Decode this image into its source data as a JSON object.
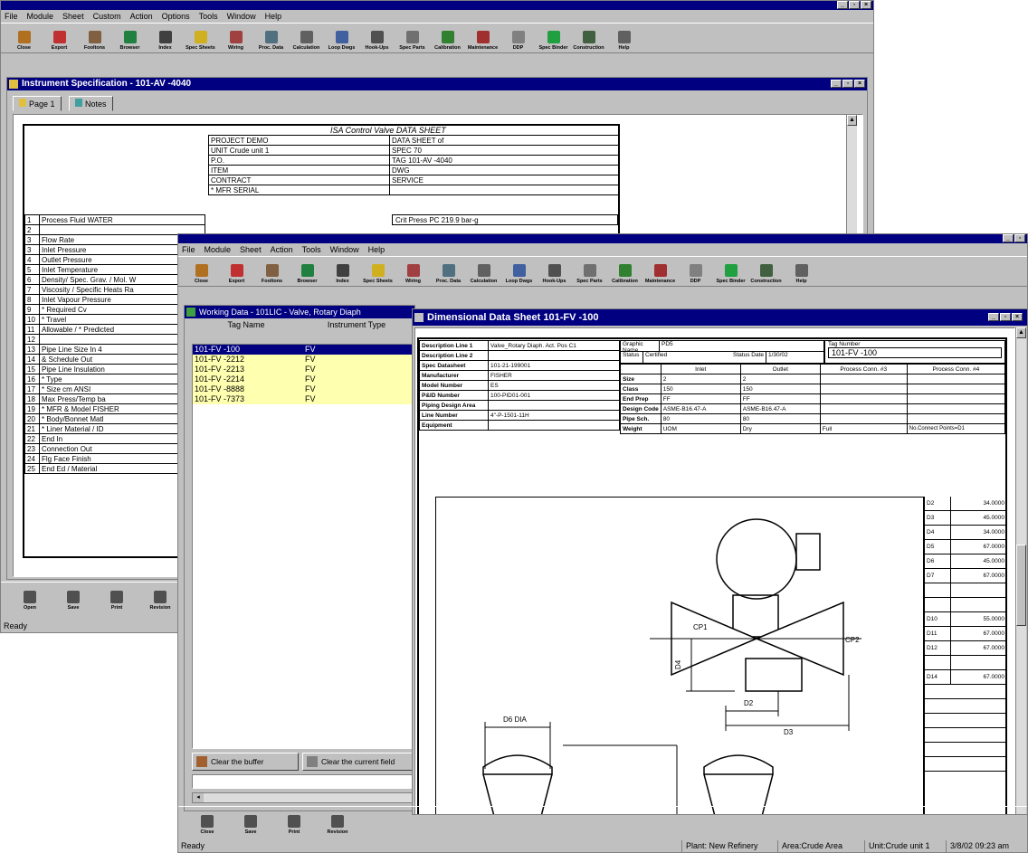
{
  "back_window": {
    "menu": [
      "File",
      "Module",
      "Sheet",
      "Custom",
      "Action",
      "Options",
      "Tools",
      "Window",
      "Help"
    ],
    "toolbar": [
      {
        "label": "Close",
        "icon": "close-icon",
        "color": "#b07020"
      },
      {
        "label": "Export",
        "icon": "export-icon",
        "color": "#c03030"
      },
      {
        "label": "Fooltons",
        "icon": "toolbox-icon",
        "color": "#806040"
      },
      {
        "label": "Browser",
        "icon": "browser-icon",
        "color": "#208040"
      },
      {
        "label": "Index",
        "icon": "index-icon",
        "color": "#404040"
      },
      {
        "label": "Spec Sheets",
        "icon": "spec-sheets-icon",
        "color": "#d0b020"
      },
      {
        "label": "Wiring",
        "icon": "wiring-icon",
        "color": "#a04040"
      },
      {
        "label": "Proc. Data",
        "icon": "process-data-icon",
        "color": "#507080"
      },
      {
        "label": "Calculation",
        "icon": "calculation-icon",
        "color": "#606060"
      },
      {
        "label": "Loop Dwgs",
        "icon": "loop-drawings-icon",
        "color": "#4060a0"
      },
      {
        "label": "Hook-Ups",
        "icon": "hook-ups-icon",
        "color": "#505050"
      },
      {
        "label": "Spec Parts",
        "icon": "spec-parts-icon",
        "color": "#707070"
      },
      {
        "label": "Calibration",
        "icon": "calibration-icon",
        "color": "#308030"
      },
      {
        "label": "Maintenance",
        "icon": "maintenance-icon",
        "color": "#a03030"
      },
      {
        "label": "DDP",
        "icon": "ddp-icon",
        "color": "#808080"
      },
      {
        "label": "Spec Binder",
        "icon": "spec-binder-icon",
        "color": "#20a040"
      },
      {
        "label": "Construction",
        "icon": "construction-icon",
        "color": "#406040"
      },
      {
        "label": "Help",
        "icon": "help-icon",
        "color": "#606060"
      }
    ],
    "spec_title": "Instrument Specification - 101-AV  -4040",
    "tabs": [
      "Page 1",
      "Notes"
    ],
    "sheet_title": "ISA Control Valve DATA SHEET",
    "header_left": [
      "PROJECT  DEMO",
      "UNIT  Crude unit 1",
      "P.O.",
      "ITEM",
      "CONTRACT",
      "* MFR SERIAL"
    ],
    "header_right": [
      "DATA SHEET         of",
      "SPEC  70",
      "TAG  101-AV  -4040",
      "DWG",
      "SERVICE",
      ""
    ],
    "rows": [
      {
        "n": "1",
        "t": "Process Fluid  WATER"
      },
      {
        "n": "2",
        "t": ""
      },
      {
        "n": "3",
        "t": "Flow Rate"
      },
      {
        "n": "3",
        "t": "Inlet Pressure"
      },
      {
        "n": "4",
        "t": "Outlet Pressure"
      },
      {
        "n": "5",
        "t": "Inlet Temperature"
      },
      {
        "n": "6",
        "t": "Density/ Spec. Grav. / Mol. W"
      },
      {
        "n": "7",
        "t": "Viscosity / Specific Heats Ra"
      },
      {
        "n": "8",
        "t": "Inlet Vapour Pressure"
      },
      {
        "n": "9",
        "t": "* Required Cv"
      },
      {
        "n": "10",
        "t": "* Travel"
      },
      {
        "n": "11",
        "t": "Allowable / * Predicted"
      },
      {
        "n": "12",
        "t": ""
      },
      {
        "n": "13",
        "t": "Pipe Line Size      In   4"
      },
      {
        "n": "14",
        "t": "& Schedule          Out"
      },
      {
        "n": "15",
        "t": "Pipe Line Insulation"
      },
      {
        "n": "16",
        "t": "* Type"
      },
      {
        "n": "17",
        "t": "* Size          cm     ANSI"
      },
      {
        "n": "18",
        "t": "Max Press/Temp         ba"
      },
      {
        "n": "19",
        "t": "* MFR & Model  FISHER"
      },
      {
        "n": "20",
        "t": "* Body/Bonnet Matl"
      },
      {
        "n": "21",
        "t": "* Liner Material / ID"
      },
      {
        "n": "22",
        "t": "End                    In"
      },
      {
        "n": "23",
        "t": "Connection             Out"
      },
      {
        "n": "24",
        "t": "Flg Face Finish"
      },
      {
        "n": "25",
        "t": "End Ed / Material"
      }
    ],
    "crit_press": "Crit Press PC   219.9    bar-g",
    "bottom_toolbar": [
      {
        "label": "Open",
        "icon": "open-icon"
      },
      {
        "label": "Save",
        "icon": "save-icon"
      },
      {
        "label": "Print",
        "icon": "print-icon"
      },
      {
        "label": "Revision",
        "icon": "revision-icon"
      }
    ],
    "status": "Ready"
  },
  "front_window": {
    "menu": [
      "File",
      "Module",
      "Sheet",
      "Action",
      "Tools",
      "Window",
      "Help"
    ],
    "working_data": {
      "title": "Working Data - 101LIC - Valve, Rotary Diaph",
      "columns": [
        "Tag Name",
        "Instrument Type"
      ],
      "rows": [
        {
          "tag": "101-FV  -100",
          "type": "FV",
          "state": "selected"
        },
        {
          "tag": "101-FV  -2212",
          "type": "FV",
          "state": "yellow"
        },
        {
          "tag": "101-FV  -2213",
          "type": "FV",
          "state": "yellow"
        },
        {
          "tag": "101-FV  -2214",
          "type": "FV",
          "state": "yellow"
        },
        {
          "tag": "101-FV  -8888",
          "type": "FV",
          "state": "yellow"
        },
        {
          "tag": "101-FV  -7373",
          "type": "FV",
          "state": "yellow"
        }
      ],
      "clear_buffer": "Clear the buffer",
      "clear_field": "Clear the current field"
    },
    "dds": {
      "title": "Dimensional Data Sheet  101-FV  -100",
      "left_labels": [
        "Description Line 1",
        "Description Line 2",
        "Spec Datasheet",
        "Manufacturer",
        "Model Number",
        "P&ID Number",
        "Piping Design Area",
        "Line Number",
        "Equipment"
      ],
      "left_values": [
        "Valve_Rotary Diaph. Act. Pos C1",
        "",
        "101-21-199001",
        "FISHER",
        "ES",
        "100-PID01-001",
        "",
        "4\"-P-1501-11H",
        ""
      ],
      "graphic_name_label": "Graphic Name",
      "graphic_name": "PD5",
      "status_label": "Status",
      "status": "Certified",
      "status_date_label": "Status Date",
      "status_date": "1/30/02",
      "tag_number_label": "Tag Number",
      "tag_number": "101-FV  -100",
      "col_inlet": "Inlet",
      "col_outlet": "Outlet",
      "col_pc3": "Process Conn. #3",
      "col_pc4": "Process Conn. #4",
      "mid_labels": [
        "Size",
        "Class",
        "End Prep",
        "Design Code",
        "Pipe Sch.",
        "Weight"
      ],
      "inlet_vals": [
        "2",
        "150",
        "FF",
        "ASME-B16.47-A",
        "80",
        "UOM"
      ],
      "outlet_vals": [
        "2",
        "150",
        "FF",
        "ASME-B16.47-A",
        "80",
        "Dry"
      ],
      "full_label": "Full",
      "no_connect": "No.Connect Points=D1",
      "dims": [
        {
          "k": "D2",
          "v": "34.0000"
        },
        {
          "k": "D3",
          "v": "45.0000"
        },
        {
          "k": "D4",
          "v": "34.0000"
        },
        {
          "k": "D5",
          "v": "67.0000"
        },
        {
          "k": "D6",
          "v": "45.0000"
        },
        {
          "k": "D7",
          "v": "67.0000"
        },
        {
          "k": "",
          "v": ""
        },
        {
          "k": "",
          "v": ""
        },
        {
          "k": "D10",
          "v": "55.0000"
        },
        {
          "k": "D11",
          "v": "67.0000"
        },
        {
          "k": "D12",
          "v": "67.0000"
        },
        {
          "k": "",
          "v": ""
        },
        {
          "k": "D14",
          "v": "67.0000"
        }
      ],
      "drawing_labels": {
        "cp1": "CP1",
        "cp2": "CP2",
        "d4": "D4",
        "d2": "D2",
        "d3": "D3",
        "d6dia": "D6 DIA"
      }
    },
    "bottom_toolbar": [
      {
        "label": "Close",
        "icon": "close-icon"
      },
      {
        "label": "Save",
        "icon": "save-icon"
      },
      {
        "label": "Print",
        "icon": "print-icon"
      },
      {
        "label": "Revision",
        "icon": "revision-icon"
      }
    ],
    "status": {
      "ready": "Ready",
      "plant": "Plant: New Refinery",
      "area": "Area:Crude Area",
      "unit": "Unit:Crude unit 1",
      "datetime": "3/8/02  09:23 am"
    }
  }
}
